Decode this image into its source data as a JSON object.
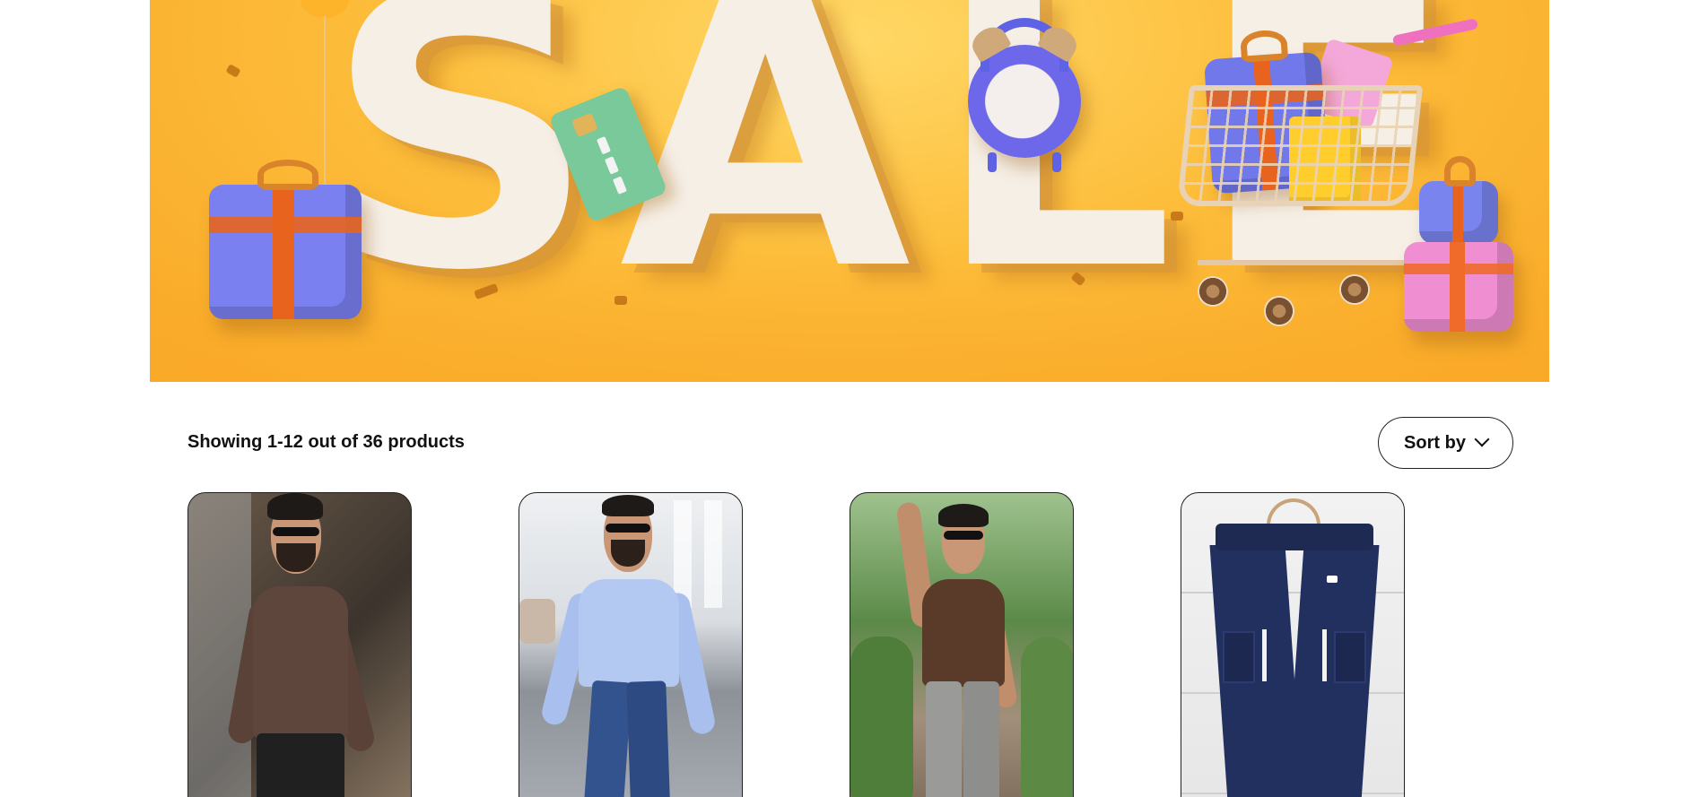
{
  "banner": {
    "headline": "SALE",
    "colors": {
      "background": "#fdbe3c",
      "letters": "#f6efe6",
      "gift_blue": "#7b80f0",
      "gift_pink": "#ef8fd2",
      "ribbon": "#e8641e",
      "card": "#79c99a",
      "clock": "#6d68ea"
    }
  },
  "listing": {
    "results_text": "Showing 1-12 out of 36 products",
    "sort_label": "Sort by",
    "sort_icon": "chevron-down-icon"
  },
  "products": [
    {
      "image": "man in brown shirt"
    },
    {
      "image": "man in light blue shirt"
    },
    {
      "image": "man in brown shirt, grey cargo"
    },
    {
      "image": "navy cargo pants"
    }
  ]
}
